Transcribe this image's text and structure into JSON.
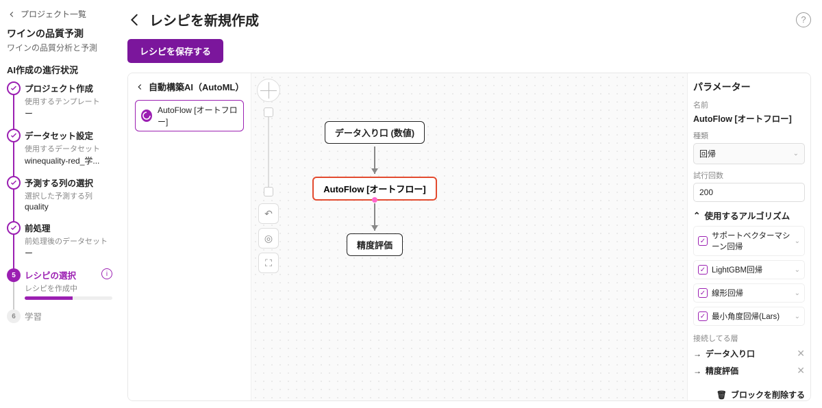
{
  "nav": {
    "back_label": "プロジェクト一覧",
    "project_title": "ワインの品質予測",
    "project_subtitle": "ワインの品質分析と予測",
    "progress_heading": "AI作成の進行状況"
  },
  "steps": [
    {
      "title": "プロジェクト作成",
      "sub": "使用するテンプレート",
      "value": "ー"
    },
    {
      "title": "データセット設定",
      "sub": "使用するデータセット",
      "value": "winequality-red_学..."
    },
    {
      "title": "予測する列の選択",
      "sub": "選択した予測する列",
      "value": "quality"
    },
    {
      "title": "前処理",
      "sub": "前処理後のデータセット",
      "value": "ー"
    },
    {
      "title": "レシピの選択",
      "sub": "レシピを作成中",
      "badge": "5"
    },
    {
      "title": "学習",
      "badge": "6"
    }
  ],
  "header": {
    "page_title": "レシピを新規作成",
    "save_button": "レシピを保存する"
  },
  "palette": {
    "heading": "自動構築AI（AutoML）",
    "block": "AutoFlow [オートフロー]"
  },
  "flow_nodes": {
    "n1": "データ入り口 (数値)",
    "n2": "AutoFlow [オートフロー]",
    "n3": "精度評価"
  },
  "panel": {
    "title": "パラメーター",
    "name_label": "名前",
    "name_value": "AutoFlow [オートフロー]",
    "kind_label": "種類",
    "kind_value": "回帰",
    "trials_label": "試行回数",
    "trials_value": "200",
    "algo_heading": "使用するアルゴリズム",
    "algos": [
      "サポートベクターマシーン回帰",
      "LightGBM回帰",
      "線形回帰",
      "最小角度回帰(Lars)"
    ],
    "connections_label": "接続してる層",
    "connections": [
      "データ入り口",
      "精度評価"
    ],
    "delete_label": "ブロックを削除する"
  }
}
